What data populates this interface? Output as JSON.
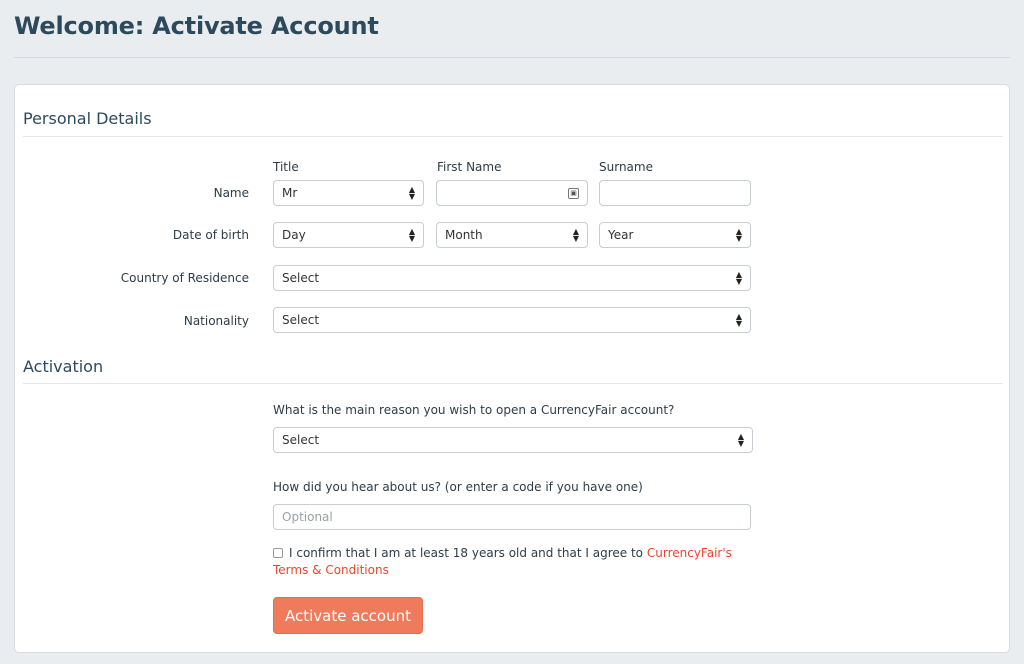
{
  "page": {
    "title": "Welcome: Activate Account"
  },
  "personal": {
    "section_title": "Personal Details",
    "columns": {
      "title": "Title",
      "first_name": "First Name",
      "surname": "Surname"
    },
    "name_label": "Name",
    "title_value": "Mr",
    "first_name_value": "",
    "surname_value": "",
    "dob_label": "Date of birth",
    "dob_day": "Day",
    "dob_month": "Month",
    "dob_year": "Year",
    "country_label": "Country of Residence",
    "country_value": "Select",
    "nationality_label": "Nationality",
    "nationality_value": "Select"
  },
  "activation": {
    "section_title": "Activation",
    "reason_question": "What is the main reason you wish to open a CurrencyFair account?",
    "reason_value": "Select",
    "hear_question": "How did you hear about us? (or enter a code if you have one)",
    "hear_placeholder": "Optional",
    "confirm_text": "I confirm that I am at least 18 years old and that I agree to",
    "terms_link": "CurrencyFair's Terms & Conditions",
    "confirm_checked": false,
    "button_label": "Activate account"
  },
  "colors": {
    "accent": "#f07b5c",
    "link": "#e8472e",
    "heading": "#2d4a5c",
    "background": "#e9edf0"
  },
  "icons": {
    "select_arrows": "updown-arrows-icon",
    "autofill": "contact-card-icon"
  }
}
